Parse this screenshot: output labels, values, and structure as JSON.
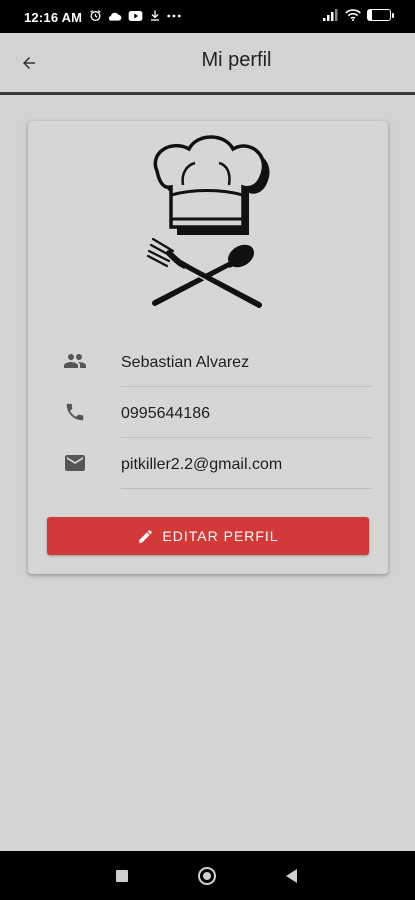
{
  "status_bar": {
    "time": "12:16 AM",
    "battery_level": "17",
    "battery_fraction": 0.17,
    "left_icons": [
      "alarm-icon",
      "cloud-icon",
      "youtube-icon",
      "download-icon",
      "more-dots-icon"
    ],
    "right_icons": [
      "signal-icon",
      "wifi-icon",
      "battery-icon"
    ]
  },
  "app_bar": {
    "title": "Mi perfil",
    "back_icon": "arrow-back-icon"
  },
  "profile": {
    "logo": "chef-hat-fork-spoon-logo",
    "name": "Sebastian Alvarez",
    "phone": "0995644186",
    "email": "pitkiller2.2@gmail.com",
    "icons": {
      "name": "people-icon",
      "phone": "phone-icon",
      "email": "email-icon"
    }
  },
  "edit_button": {
    "label": "EDITAR PERFIL",
    "icon": "pencil-icon",
    "color": "#d23a3a"
  },
  "nav_bar": {
    "items": [
      "recents-square",
      "home-circle",
      "back-triangle"
    ]
  },
  "colors": {
    "background": "#d3d3d3",
    "card": "#d6d6d6",
    "accent": "#d23a3a",
    "icon": "#555555"
  }
}
